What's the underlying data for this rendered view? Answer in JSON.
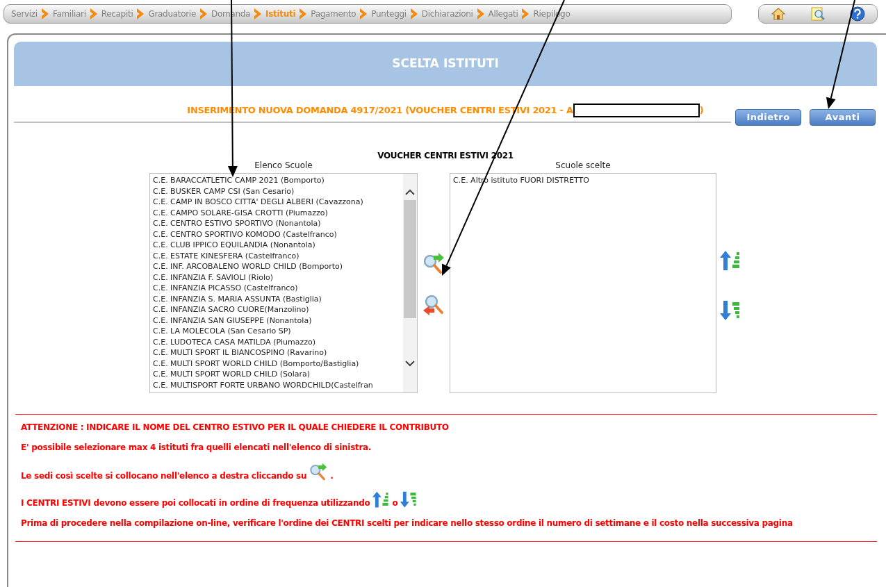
{
  "steps": [
    {
      "label": "Servizi",
      "selected": false
    },
    {
      "label": "Familiari",
      "selected": false
    },
    {
      "label": "Recapiti",
      "selected": false
    },
    {
      "label": "Graduatorie",
      "selected": false
    },
    {
      "label": "Domanda",
      "selected": false
    },
    {
      "label": "Istituti",
      "selected": true
    },
    {
      "label": "Pagamento",
      "selected": false
    },
    {
      "label": "Punteggi",
      "selected": false
    },
    {
      "label": "Dichiarazioni",
      "selected": false
    },
    {
      "label": "Allegati",
      "selected": false
    },
    {
      "label": "Riepilogo",
      "selected": false
    }
  ],
  "header": {
    "title": "SCELTA ISTITUTI"
  },
  "subtitle": {
    "text": "INSERIMENTO NUOVA DOMANDA 4917/2021 (VOUCHER CENTRI ESTIVI 2021 - A",
    "end": ")"
  },
  "buttons": [
    "Indietro",
    "Avanti"
  ],
  "section_title": "VOUCHER CENTRI ESTIVI 2021",
  "available": {
    "label": "Elenco Scuole",
    "items": [
      "C.E. BARACCATLETIC CAMP 2021 (Bomporto)",
      "C.E. BUSKER CAMP CSI (San Cesario)",
      "C.E. CAMP IN BOSCO CITTA' DEGLI ALBERI (Cavazzona)",
      "C.E. CAMPO SOLARE-GISA CROTTI (Piumazzo)",
      "C.E. CENTRO ESTIVO SPORTIVO (Nonantola)",
      "C.E. CENTRO SPORTIVO KOMODO (Castelfranco)",
      "C.E. CLUB IPPICO EQUILANDIA (Nonantola)",
      "C.E. ESTATE KINESFERA (Castelfranco)",
      "C.E. INF. ARCOBALENO WORLD CHILD (Bomporto)",
      "C.E. INFANZIA F. SAVIOLI (Riolo)",
      "C.E. INFANZIA PICASSO (Castelfranco)",
      "C.E. INFANZIA S. MARIA ASSUNTA (Bastiglia)",
      "C.E. INFANZIA SACRO CUORE(Manzolino)",
      "C.E. INFANZIA SAN GIUSEPPE (Nonantola)",
      "C.E. LA MOLECOLA (San Cesario SP)",
      "C.E. LUDOTECA CASA MATILDA (Piumazzo)",
      "C.E. MULTI SPORT IL BIANCOSPINO (Ravarino)",
      "C.E. MULTI SPORT WORLD CHILD (Bomporto/Bastiglia)",
      "C.E. MULTI SPORT WORLD CHILD (Solara)",
      "C.E. MULTISPORT FORTE URBANO WORDCHILD(Castelfran"
    ]
  },
  "chosen": {
    "label": "Scuole scelte",
    "items": [
      "C.E. Altro istituto FUORI DISTRETTO"
    ]
  },
  "notes": [
    {
      "parts": [
        {
          "kind": "text",
          "text": "ATTENZIONE : INDICARE IL NOME DEL CENTRO ESTIVO PER IL QUALE CHIEDERE IL CONTRIBUTO"
        }
      ]
    },
    {
      "parts": [
        {
          "kind": "text",
          "text": "E' possibile selezionare max 4 istituti fra quelli elencati nell'elenco di sinistra."
        }
      ]
    },
    {
      "parts": [
        {
          "kind": "text",
          "text": "Le sedi così scelte si collocano nell'elenco a destra cliccando su"
        },
        {
          "kind": "add"
        },
        {
          "kind": "text",
          "text": "."
        }
      ]
    },
    {
      "parts": [
        {
          "kind": "text",
          "text": "I CENTRI ESTIVI devono essere poi collocati in ordine di frequenza utilizzando"
        },
        {
          "kind": "up"
        },
        {
          "kind": "text",
          "text": "o"
        },
        {
          "kind": "down"
        }
      ]
    },
    {
      "parts": [
        {
          "kind": "text",
          "text": "Prima di procedere nella compilazione on-line, verificare l'ordine dei CENTRI scelti per indicare nello stesso ordine il numero di settimane e il costo nella successiva pagina"
        }
      ]
    }
  ]
}
